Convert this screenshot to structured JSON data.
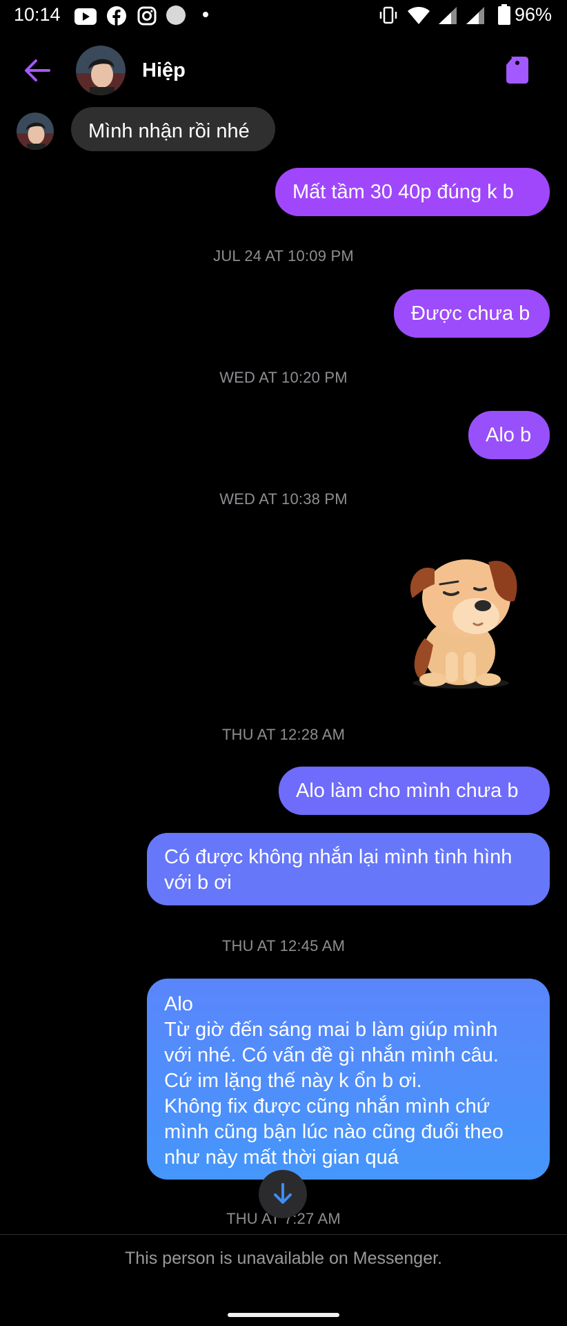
{
  "status_bar": {
    "time": "10:14",
    "battery": "96%",
    "left_icons": [
      "youtube-icon",
      "facebook-icon",
      "instagram-icon",
      "circle-notification-icon",
      "dot-icon"
    ],
    "right_icons": [
      "vibrate-icon",
      "wifi-icon",
      "signal-icon",
      "signal-icon",
      "battery-icon"
    ]
  },
  "header": {
    "contact_name": "Hiệp",
    "accent_color": "#a259ff"
  },
  "messages": [
    {
      "type": "incoming",
      "text": "Mình nhận rồi nhé"
    },
    {
      "type": "outgoing",
      "text": "Mất tầm 30 40p đúng k b"
    },
    {
      "type": "timestamp",
      "text": "JUL 24 AT 10:09 PM"
    },
    {
      "type": "outgoing",
      "text": "Được chưa b"
    },
    {
      "type": "timestamp",
      "text": "WED AT 10:20 PM"
    },
    {
      "type": "outgoing",
      "text": "Alo b"
    },
    {
      "type": "timestamp",
      "text": "WED AT 10:38 PM"
    },
    {
      "type": "sticker",
      "sticker": "sad-dog-sticker"
    },
    {
      "type": "timestamp",
      "text": "THU AT 12:28 AM"
    },
    {
      "type": "outgoing",
      "text": "Alo làm cho mình chưa b"
    },
    {
      "type": "outgoing",
      "lines": [
        "Có được không nhắn lại mình tình hình",
        "với b ơi"
      ]
    },
    {
      "type": "timestamp",
      "text": "THU AT 12:45 AM"
    },
    {
      "type": "outgoing",
      "lines": [
        "Alo",
        "Từ giờ đến sáng mai b làm giúp mình",
        "với nhé. Có vấn đề gì nhắn mình câu.",
        "Cứ im lặng thế này k ổn b ơi.",
        "Không fix được cũng nhắn mình chứ",
        "mình cũng bận lúc nào cũng đuổi theo",
        "như này mất thời gian quá"
      ]
    },
    {
      "type": "timestamp",
      "text": "THU AT 7:27 AM"
    }
  ],
  "footer": {
    "unavailable_text": "This person is unavailable on Messenger."
  }
}
